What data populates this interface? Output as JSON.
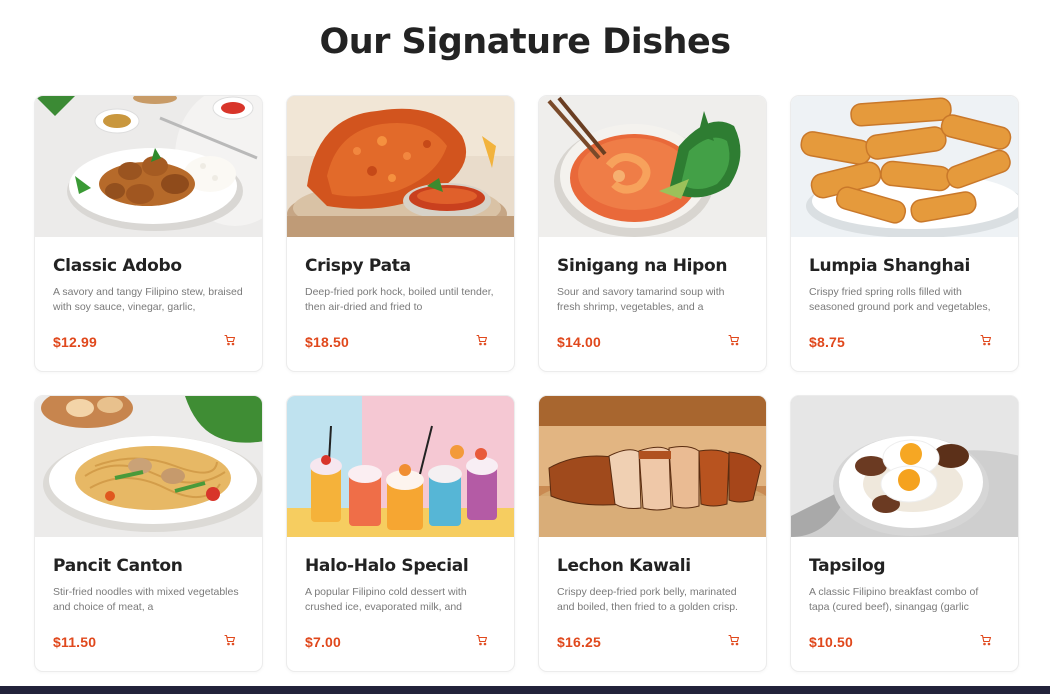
{
  "section": {
    "title": "Our Signature Dishes"
  },
  "accent_color": "#e0481c",
  "dishes": [
    {
      "name": "Classic Adobo",
      "desc": "A savory and tangy Filipino stew, braised with soy sauce, vinegar, garlic,",
      "price": "$12.99",
      "icon": "cart-icon"
    },
    {
      "name": "Crispy Pata",
      "desc": "Deep-fried pork hock, boiled until tender, then air-dried and fried to",
      "price": "$18.50",
      "icon": "cart-icon"
    },
    {
      "name": "Sinigang na Hipon",
      "desc": "Sour and savory tamarind soup with fresh shrimp, vegetables, and a",
      "price": "$14.00",
      "icon": "cart-icon"
    },
    {
      "name": "Lumpia Shanghai",
      "desc": "Crispy fried spring rolls filled with seasoned ground pork and vegetables,",
      "price": "$8.75",
      "icon": "cart-icon"
    },
    {
      "name": "Pancit Canton",
      "desc": "Stir-fried noodles with mixed vegetables and choice of meat, a",
      "price": "$11.50",
      "icon": "cart-icon"
    },
    {
      "name": "Halo-Halo Special",
      "desc": "A popular Filipino cold dessert with crushed ice, evaporated milk, and",
      "price": "$7.00",
      "icon": "cart-icon"
    },
    {
      "name": "Lechon Kawali",
      "desc": "Crispy deep-fried pork belly, marinated and boiled, then fried to a golden crisp.",
      "price": "$16.25",
      "icon": "cart-icon"
    },
    {
      "name": "Tapsilog",
      "desc": "A classic Filipino breakfast combo of tapa (cured beef), sinangag (garlic",
      "price": "$10.50",
      "icon": "cart-icon"
    }
  ]
}
